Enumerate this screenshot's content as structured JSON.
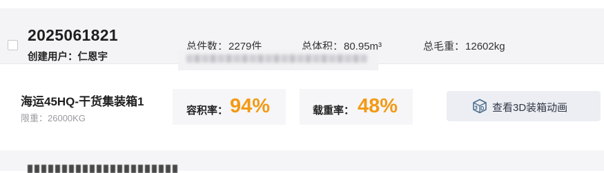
{
  "plan": {
    "number": "2025061821",
    "creator_label": "创建用户：",
    "creator_name": "仁恩宇",
    "total_count_label": "总件数：",
    "total_count_value": "2279件",
    "total_volume_label": "总体积：",
    "total_volume_value": "80.95m³",
    "total_weight_label": "总毛重：",
    "total_weight_value": "12602kg"
  },
  "container": {
    "name": "海运45HQ-干货集装箱1",
    "weight_limit_label": "限重：",
    "weight_limit_value": "26000KG",
    "volume_rate_label": "容积率：",
    "volume_rate_value": "94%",
    "load_rate_label": "载重率：",
    "load_rate_value": "48%",
    "view_3d_label": "查看3D装箱动画"
  },
  "colors": {
    "rate_accent": "#f29a16",
    "header_bg": "#f4f4f6",
    "button_bg": "#eceef3",
    "icon_color": "#4a6b8a"
  },
  "icons": {
    "view_3d": "3d-box-icon"
  }
}
